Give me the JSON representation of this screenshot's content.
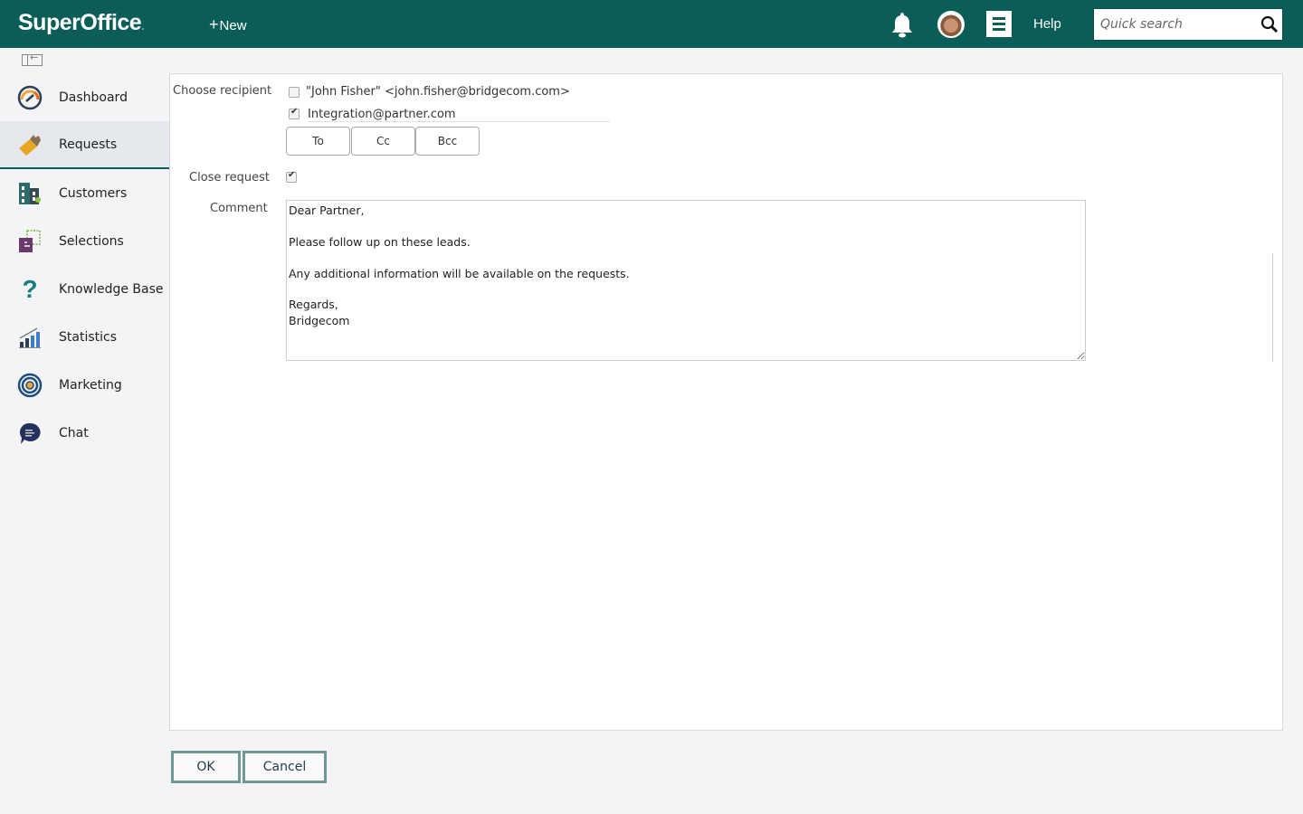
{
  "header": {
    "logo": "SuperOffice",
    "new_label": "New",
    "help_label": "Help",
    "search_placeholder": "Quick search",
    "icons": [
      "bell-icon",
      "avatar",
      "menu-icon",
      "search-icon"
    ]
  },
  "sidebar": {
    "items": [
      {
        "label": "Dashboard",
        "icon": "dashboard-gauge-icon",
        "active": false
      },
      {
        "label": "Requests",
        "icon": "ticket-icon",
        "active": true
      },
      {
        "label": "Customers",
        "icon": "buildings-icon",
        "active": false
      },
      {
        "label": "Selections",
        "icon": "selection-icon",
        "active": false
      },
      {
        "label": "Knowledge Base",
        "icon": "question-icon",
        "active": false
      },
      {
        "label": "Statistics",
        "icon": "bar-chart-icon",
        "active": false
      },
      {
        "label": "Marketing",
        "icon": "target-icon",
        "active": false
      },
      {
        "label": "Chat",
        "icon": "chat-bubble-icon",
        "active": false
      }
    ]
  },
  "form": {
    "choose_recipient_label": "Choose recipient",
    "recipients": [
      {
        "text": "\"John Fisher\" <john.fisher@bridgecom.com>",
        "checked": false
      },
      {
        "text": "Integration@partner.com",
        "checked": true
      }
    ],
    "recipient_buttons": [
      "To",
      "Cc",
      "Bcc"
    ],
    "close_request_label": "Close request",
    "close_request_checked": true,
    "comment_label": "Comment",
    "comment_value": "Dear Partner,\n\nPlease follow up on these leads.\n\nAny additional information will be available on the requests.\n\nRegards,\nBridgecom"
  },
  "actions": {
    "ok_label": "OK",
    "cancel_label": "Cancel"
  }
}
